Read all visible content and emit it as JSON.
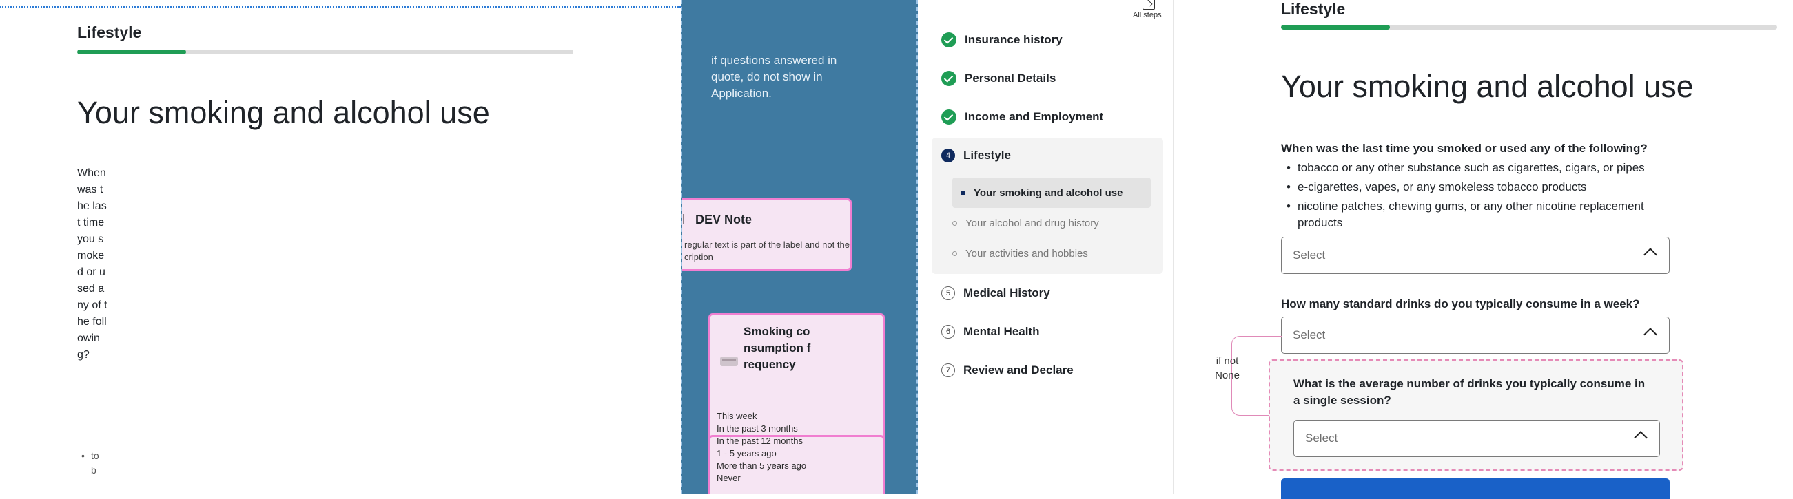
{
  "section_title": "Lifestyle",
  "page_heading": "Your smoking and alcohol use",
  "progress_fraction": 0.22,
  "annotation": {
    "note": "if questions answered in quote, do not show in Application.",
    "dev_note_title": "DEV Note",
    "dev_note_body": "regular text is part of the label  and not the cription",
    "smoking_card_title": "Smoking consumption frequency",
    "smoking_options": [
      "This week",
      "In the past 3 months",
      "In the past 12 months",
      "1 - 5 years ago",
      "More than 5 years ago",
      "Never"
    ]
  },
  "nav": {
    "all_steps": "All steps",
    "steps": [
      {
        "label": "Insurance history",
        "state": "done"
      },
      {
        "label": "Personal Details",
        "state": "done"
      },
      {
        "label": "Income and Employment",
        "state": "done"
      },
      {
        "label": "Lifestyle",
        "state": "active",
        "num": "4"
      },
      {
        "label": "Medical History",
        "state": "todo",
        "num": "5"
      },
      {
        "label": "Mental Health",
        "state": "todo",
        "num": "6"
      },
      {
        "label": "Review and Declare",
        "state": "todo",
        "num": "7"
      }
    ],
    "substeps": [
      {
        "label": "Your smoking and alcohol use",
        "current": true
      },
      {
        "label": "Your alcohol and drug history",
        "current": false
      },
      {
        "label": "Your activities and hobbies",
        "current": false
      }
    ]
  },
  "form": {
    "q1": "When was the last time you smoked or used any of the following?",
    "q1_bullets": [
      "tobacco or any other substance such as cigarettes, cigars, or pipes",
      "e-cigarettes, vapes, or any smokeless tobacco products",
      "nicotine patches, chewing gums, or any other nicotine replacement products"
    ],
    "q2": "How many standard drinks do you typically consume in a week?",
    "q3": "What is the average number of drinks you typically consume in a single session?",
    "select_placeholder": "Select",
    "condition_label": "if not None"
  },
  "left_narrow": {
    "question": "When was the last time you smoked or used any of the following?",
    "bullet_fragment": "tob"
  },
  "colors": {
    "accent_green": "#1f9d55",
    "nav_active": "#0f2a5e",
    "annotation_blue": "#3f7aa1",
    "annotation_pink": "#f07ed0",
    "primary_button": "#1961c8"
  }
}
